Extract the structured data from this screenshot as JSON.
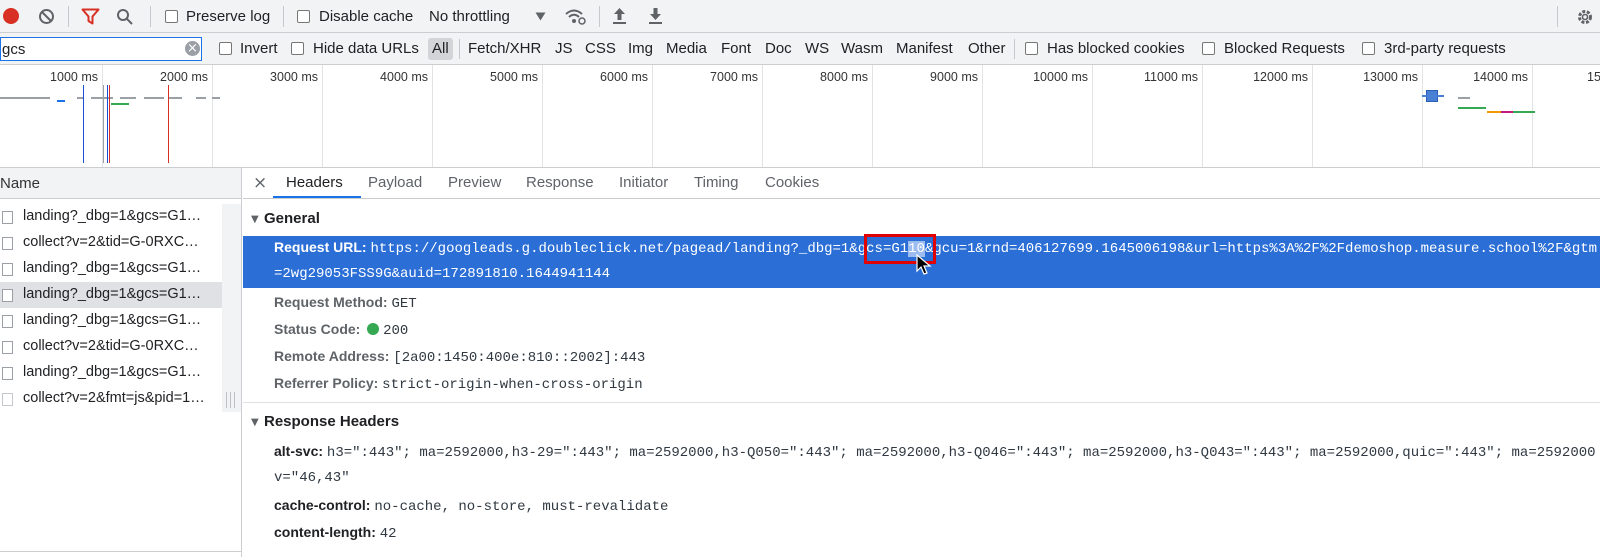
{
  "toolbar": {
    "preserve_log": "Preserve log",
    "disable_cache": "Disable cache",
    "throttling": "No throttling"
  },
  "filter_bar": {
    "filter_value": "gcs",
    "invert": "Invert",
    "hide_data_urls": "Hide data URLs",
    "types": [
      "All",
      "Fetch/XHR",
      "JS",
      "CSS",
      "Img",
      "Media",
      "Font",
      "Doc",
      "WS",
      "Wasm",
      "Manifest",
      "Other"
    ],
    "has_blocked_cookies": "Has blocked cookies",
    "blocked_requests": "Blocked Requests",
    "third_party": "3rd-party requests"
  },
  "timeline": {
    "ticks": [
      "1000 ms",
      "2000 ms",
      "3000 ms",
      "4000 ms",
      "5000 ms",
      "6000 ms",
      "7000 ms",
      "8000 ms",
      "9000 ms",
      "10000 ms",
      "11000 ms",
      "12000 ms",
      "13000 ms",
      "14000 ms",
      "15"
    ]
  },
  "request_list": {
    "header": "Name",
    "rows": [
      "landing?_dbg=1&gcs=G1…",
      "collect?v=2&tid=G-0RXC…",
      "landing?_dbg=1&gcs=G1…",
      "landing?_dbg=1&gcs=G1…",
      "landing?_dbg=1&gcs=G1…",
      "collect?v=2&tid=G-0RXC…",
      "landing?_dbg=1&gcs=G1…",
      "collect?v=2&fmt=js&pid=1…"
    ]
  },
  "detail_tabs": [
    "Headers",
    "Payload",
    "Preview",
    "Response",
    "Initiator",
    "Timing",
    "Cookies"
  ],
  "general": {
    "title": "General",
    "request_url_label": "Request URL:",
    "request_url_pre": "https://googleads.g.doubleclick.net/pagead/landing?_dbg=1&",
    "request_url_hl1": "gcs=G1",
    "request_url_hl2": "10",
    "request_url_post": "&gcu=1&rnd=406127699.1645006198&url=https%3A%2F%2Fdemoshop.measure.school%2F&gtm",
    "request_url_line2": "=2wg29053FSS9G&auid=172891810.1644941144",
    "request_method_label": "Request Method:",
    "request_method": "GET",
    "status_code_label": "Status Code:",
    "status_code": "200",
    "remote_address_label": "Remote Address:",
    "remote_address": "[2a00:1450:400e:810::2002]:443",
    "referrer_policy_label": "Referrer Policy:",
    "referrer_policy": "strict-origin-when-cross-origin"
  },
  "response_headers": {
    "title": "Response Headers",
    "alt_svc_label": "alt-svc:",
    "alt_svc_line1": "h3=\":443\"; ma=2592000,h3-29=\":443\"; ma=2592000,h3-Q050=\":443\"; ma=2592000,h3-Q046=\":443\"; ma=2592000,h3-Q043=\":443\"; ma=2592000,quic=\":443\"; ma=2592000",
    "alt_svc_line2": "v=\"46,43\"",
    "cache_control_label": "cache-control:",
    "cache_control": "no-cache, no-store, must-revalidate",
    "content_length_label": "content-length:",
    "content_length": "42"
  },
  "colors": {
    "accent": "#1a73e8",
    "selected_row_bg": "#d6d9dd",
    "url_highlight_bg": "#2b6fd6",
    "status_green": "#34a853",
    "annotation_red": "#e00000",
    "record_red": "#d93025"
  }
}
